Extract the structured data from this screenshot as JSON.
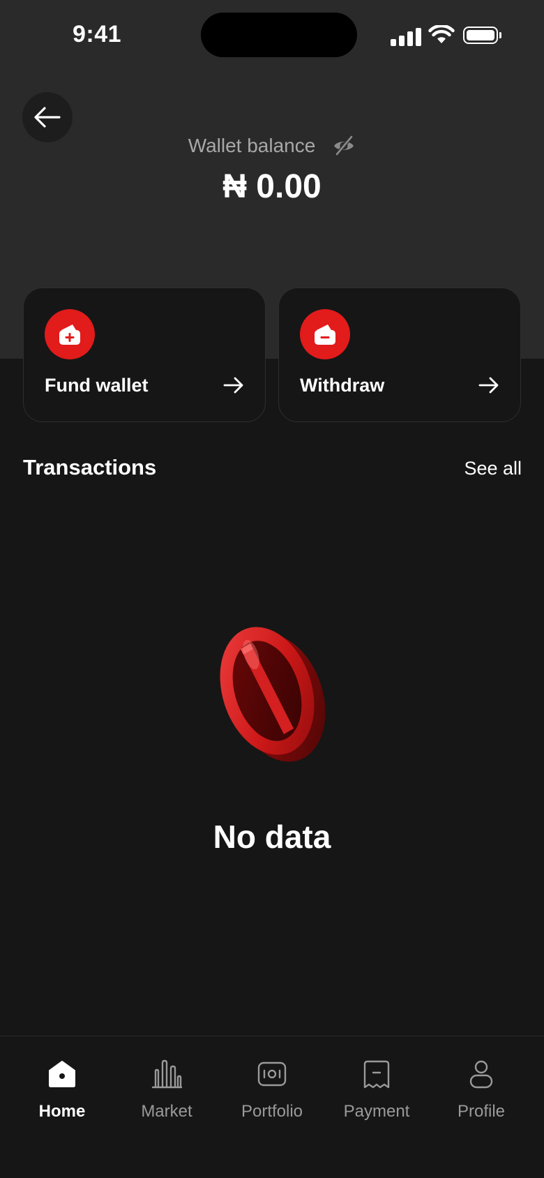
{
  "status_bar": {
    "time": "9:41"
  },
  "header": {
    "balance_label": "Wallet balance",
    "balance_amount": "₦ 0.00"
  },
  "actions": [
    {
      "label": "Fund wallet",
      "icon": "wallet-plus-icon"
    },
    {
      "label": "Withdraw",
      "icon": "wallet-minus-icon"
    }
  ],
  "transactions": {
    "title": "Transactions",
    "see_all_label": "See all",
    "empty_text": "No data"
  },
  "tab_bar": {
    "items": [
      {
        "label": "Home",
        "icon": "home-icon",
        "active": true
      },
      {
        "label": "Market",
        "icon": "market-icon",
        "active": false
      },
      {
        "label": "Portfolio",
        "icon": "portfolio-icon",
        "active": false
      },
      {
        "label": "Payment",
        "icon": "payment-icon",
        "active": false
      },
      {
        "label": "Profile",
        "icon": "profile-icon",
        "active": false
      }
    ]
  },
  "colors": {
    "accent": "#e21b1b",
    "background": "#161616",
    "header_background": "#2a2a2a",
    "muted_text": "#9a9a9a"
  }
}
